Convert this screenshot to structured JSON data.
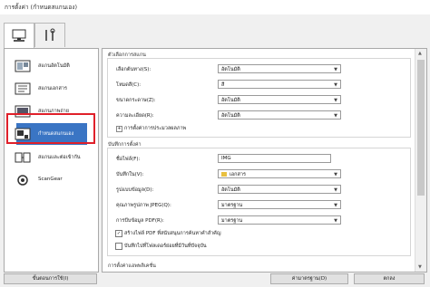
{
  "window": {
    "title": "การตั้งค่า (กำหนดสแกนเอง)"
  },
  "tabs": [
    {
      "icon": "scan-from-computer-icon",
      "active": true
    },
    {
      "icon": "tools-icon",
      "active": false
    }
  ],
  "sidebar": {
    "items": [
      {
        "label": "สแกนอัตโนมัติ",
        "icon": "auto-scan-icon"
      },
      {
        "label": "สแกนเอกสาร",
        "icon": "document-scan-icon"
      },
      {
        "label": "สแกนภาพถ่าย",
        "icon": "photo-scan-icon"
      },
      {
        "label": "กำหนดสแกนเอง",
        "icon": "custom-scan-icon",
        "selected": true
      },
      {
        "label": "สแกนและต่อเข้ากัน",
        "icon": "stitch-scan-icon"
      },
      {
        "label": "ScanGear",
        "icon": "scangear-icon"
      }
    ]
  },
  "scan_options": {
    "title": "ตัวเลือกการสแกน",
    "rows": [
      {
        "label": "เลือกต้นทาง(S):",
        "value": "อัตโนมัติ"
      },
      {
        "label": "โหมดสี(C):",
        "value": "สี"
      },
      {
        "label": "ขนาดกระดาษ(Z):",
        "value": "อัตโนมัติ"
      },
      {
        "label": "ความละเอียด(R):",
        "value": "อัตโนมัติ"
      }
    ],
    "expander_label": "การตั้งค่าการประมวลผลภาพ"
  },
  "save_settings": {
    "title": "บันทึกการตั้งค่า",
    "rows": [
      {
        "label": "ชื่อไฟล์(F):",
        "value": "IMG"
      },
      {
        "label": "บันทึกใน(V):",
        "value": "เอกสาร"
      },
      {
        "label": "รูปแบบข้อมูล(D):",
        "value": "อัตโนมัติ"
      },
      {
        "label": "คุณภาพรูปภาพ JPEG(Q):",
        "value": "มาตรฐาน"
      },
      {
        "label": "การบีบข้อมูล PDF(R):",
        "value": "มาตรฐาน"
      }
    ],
    "checkbox1": {
      "label": "สร้างไฟล์ PDF ที่สนับสนุนการค้นหาคำสำคัญ",
      "checked": true
    },
    "checkbox2": {
      "label": "บันทึกไปที่โฟลเดอร์ย่อยที่มีวันที่ปัจจุบัน",
      "checked": false
    }
  },
  "app_settings_title": "การตั้งค่าแอพพลิเคชั่น",
  "buttons": {
    "instructions": "ขั้นตอนการใช้(I)",
    "defaults": "ค่ามาตรฐาน(D)",
    "ok": "ตกลง"
  },
  "colors": {
    "selection": "#3a75c4",
    "highlight_border": "#e0202a"
  }
}
